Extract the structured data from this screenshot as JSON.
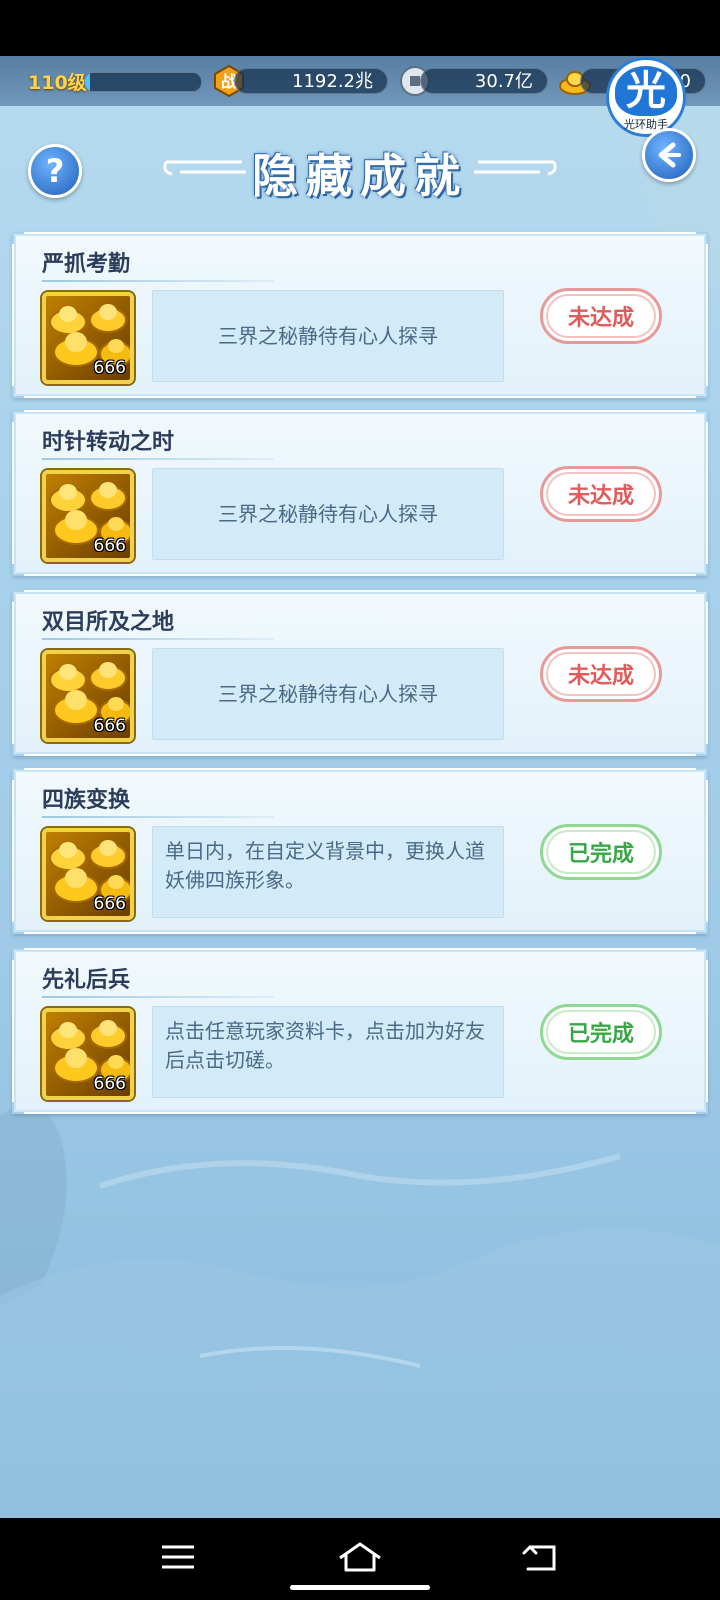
{
  "topbar": {
    "level": "110级",
    "level_progress": 0.04,
    "combat_power": "1192.2兆",
    "coins": "30.7亿",
    "gold": "60",
    "helper_char": "光",
    "helper_label": "光环助手"
  },
  "header": {
    "title": "隐藏成就",
    "help_label": "?"
  },
  "achievements": [
    {
      "name": "严抓考勤",
      "reward_count": "666",
      "description": "三界之秘静待有心人探寻",
      "status": "未达成",
      "completed": false
    },
    {
      "name": "时针转动之时",
      "reward_count": "666",
      "description": "三界之秘静待有心人探寻",
      "status": "未达成",
      "completed": false
    },
    {
      "name": "双目所及之地",
      "reward_count": "666",
      "description": "三界之秘静待有心人探寻",
      "status": "未达成",
      "completed": false
    },
    {
      "name": "四族变换",
      "reward_count": "666",
      "description": "单日内，在自定义背景中，更换人道妖佛四族形象。",
      "status": "已完成",
      "completed": true
    },
    {
      "name": "先礼后兵",
      "reward_count": "666",
      "description": "点击任意玩家资料卡，点击加为好友后点击切磋。",
      "status": "已完成",
      "completed": true
    }
  ],
  "icons": {
    "combat": "combat-icon",
    "coin": "copper-coin-icon",
    "gold": "gold-ingot-icon",
    "back": "back-arrow-icon",
    "nav_menu": "menu-icon",
    "nav_home": "home-icon",
    "nav_back": "back-icon"
  }
}
